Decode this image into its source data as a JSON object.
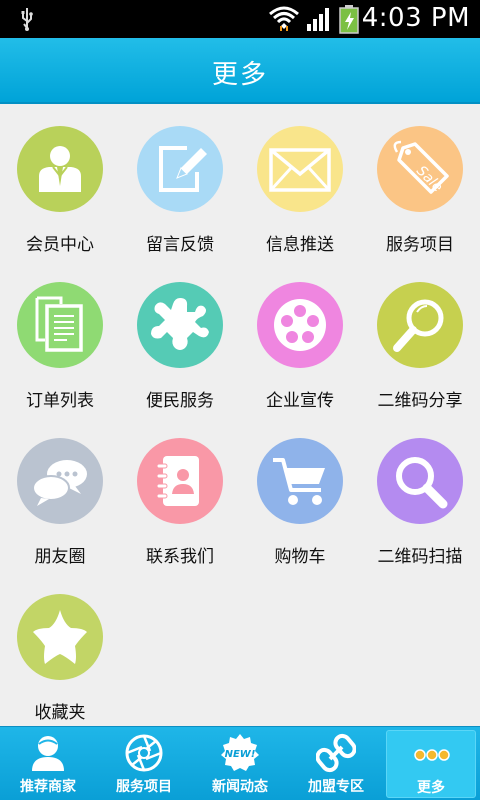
{
  "statusbar": {
    "time": "4:03 PM"
  },
  "header": {
    "title": "更多"
  },
  "grid": {
    "items": [
      {
        "label": "会员中心",
        "color": "#b9d15a",
        "icon": "member-icon"
      },
      {
        "label": "留言反馈",
        "color": "#a9daf6",
        "icon": "feedback-icon"
      },
      {
        "label": "信息推送",
        "color": "#f9e58b",
        "icon": "mail-icon"
      },
      {
        "label": "服务项目",
        "color": "#fbc585",
        "icon": "sale-tag-icon"
      },
      {
        "label": "订单列表",
        "color": "#8fda73",
        "icon": "documents-icon"
      },
      {
        "label": "便民服务",
        "color": "#55cbb5",
        "icon": "puzzle-icon"
      },
      {
        "label": "企业宣传",
        "color": "#ef86e0",
        "icon": "film-reel-icon"
      },
      {
        "label": "二维码分享",
        "color": "#c6d04f",
        "icon": "magnifier-icon"
      },
      {
        "label": "朋友圈",
        "color": "#bac3d0",
        "icon": "chat-bubbles-icon"
      },
      {
        "label": "联系我们",
        "color": "#f998a7",
        "icon": "contacts-book-icon"
      },
      {
        "label": "购物车",
        "color": "#8fb3ea",
        "icon": "cart-icon"
      },
      {
        "label": "二维码扫描",
        "color": "#b48bf0",
        "icon": "search-icon"
      },
      {
        "label": "收藏夹",
        "color": "#c2d566",
        "icon": "star-icon"
      }
    ]
  },
  "tabbar": {
    "tabs": [
      {
        "label": "推荐商家",
        "icon": "user-icon"
      },
      {
        "label": "服务项目",
        "icon": "aperture-icon"
      },
      {
        "label": "新闻动态",
        "icon": "new-badge-icon",
        "badge": "NEW!"
      },
      {
        "label": "加盟专区",
        "icon": "chain-link-icon"
      },
      {
        "label": "更多",
        "icon": "more-dots-icon"
      }
    ]
  }
}
